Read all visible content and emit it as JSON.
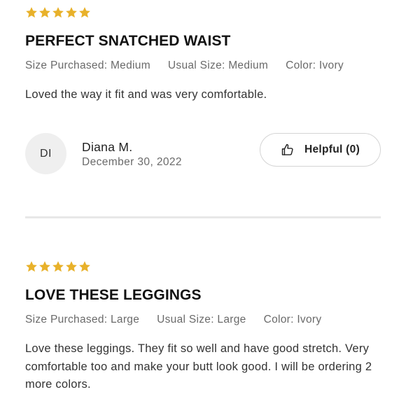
{
  "colors": {
    "star": "#e8b12a",
    "divider": "#e8e8e8",
    "avatar_bg": "#efefef"
  },
  "reviews": [
    {
      "rating": 5,
      "title": "PERFECT SNATCHED WAIST",
      "size_purchased": "Size Purchased: Medium",
      "usual_size": "Usual Size: Medium",
      "color": "Color: Ivory",
      "body": "Loved the way it fit and was very comfortable.",
      "reviewer": {
        "initials": "DI",
        "name": "Diana M.",
        "date": "December 30, 2022"
      },
      "helpful_label": "Helpful (0)",
      "helpful_icon": "thumbs-up-icon"
    },
    {
      "rating": 5,
      "title": "LOVE THESE LEGGINGS",
      "size_purchased": "Size Purchased: Large",
      "usual_size": "Usual Size: Large",
      "color": "Color: Ivory",
      "body": "Love these leggings. They fit so well and have good stretch. Very comfortable too and make your butt look good. I will be ordering 2 more colors."
    }
  ]
}
